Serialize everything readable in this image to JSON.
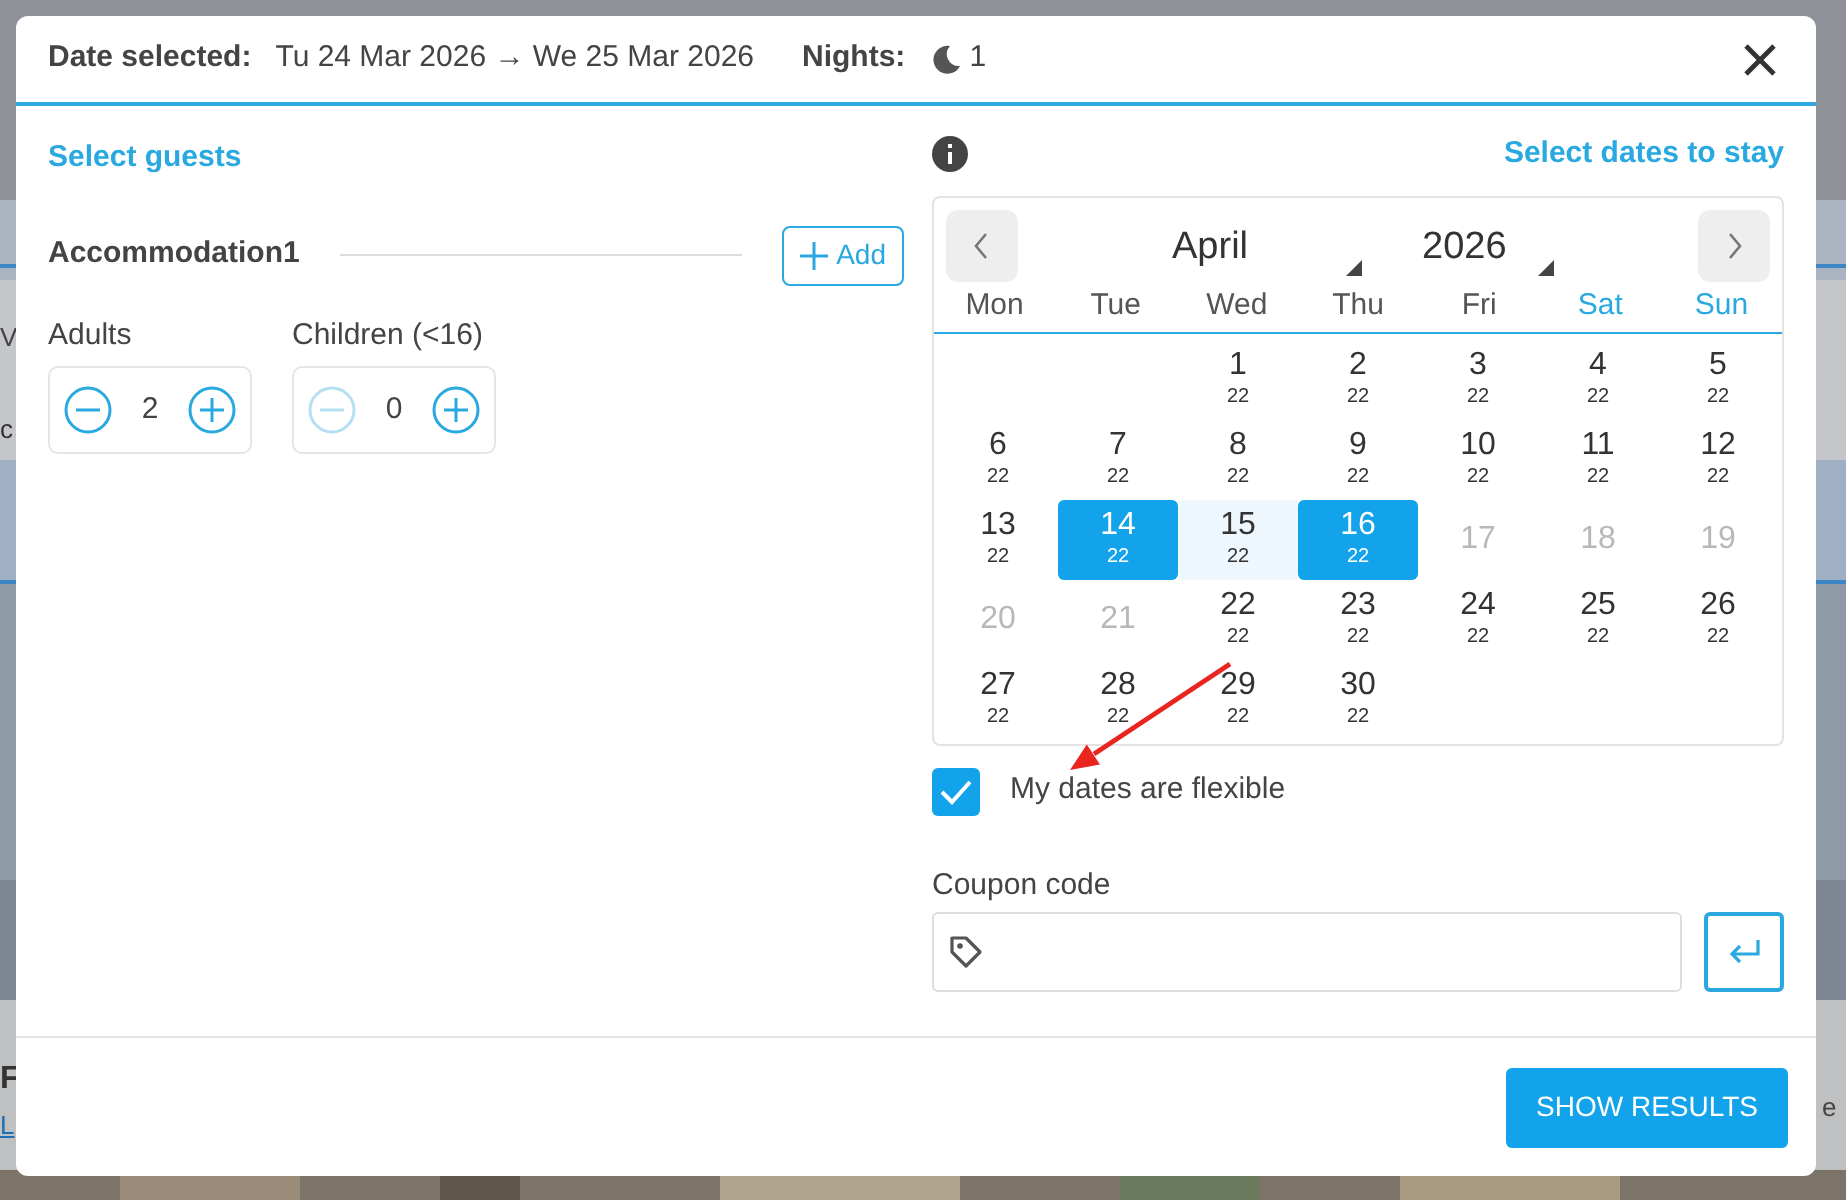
{
  "background_texts": [
    {
      "text": "V",
      "kind": "left"
    },
    {
      "text": "c",
      "kind": "left"
    },
    {
      "text": "F",
      "kind": "heading"
    },
    {
      "text": "L",
      "kind": "link"
    },
    {
      "text": "e",
      "kind": "right"
    }
  ],
  "header": {
    "label": "Date selected:",
    "dates": "Tu 24 Mar 2026 → We 25 Mar 2026",
    "nights_label": "Nights:",
    "nights": "1"
  },
  "guests": {
    "title": "Select guests",
    "accommodation": "Accommodation1",
    "add_button": "Add",
    "counters": [
      {
        "label": "Adults",
        "value": "2",
        "minus_disabled": false
      },
      {
        "label": "Children (<16)",
        "value": "0",
        "minus_disabled": true
      }
    ]
  },
  "calendar": {
    "title": "Select dates to stay",
    "month": "April",
    "year": "2026",
    "weekdays": [
      {
        "label": "Mon",
        "weekend": false
      },
      {
        "label": "Tue",
        "weekend": false
      },
      {
        "label": "Wed",
        "weekend": false
      },
      {
        "label": "Thu",
        "weekend": false
      },
      {
        "label": "Fri",
        "weekend": false
      },
      {
        "label": "Sat",
        "weekend": true
      },
      {
        "label": "Sun",
        "weekend": true
      }
    ],
    "weeks": [
      [
        {
          "kind": "blank"
        },
        {
          "kind": "blank"
        },
        {
          "kind": "day",
          "day": "1",
          "price": "22",
          "selected": false,
          "in_range": false,
          "disabled": false
        },
        {
          "kind": "day",
          "day": "2",
          "price": "22",
          "selected": false,
          "in_range": false,
          "disabled": false
        },
        {
          "kind": "day",
          "day": "3",
          "price": "22",
          "selected": false,
          "in_range": false,
          "disabled": false
        },
        {
          "kind": "day",
          "day": "4",
          "price": "22",
          "selected": false,
          "in_range": false,
          "disabled": false
        },
        {
          "kind": "day",
          "day": "5",
          "price": "22",
          "selected": false,
          "in_range": false,
          "disabled": false
        }
      ],
      [
        {
          "kind": "day",
          "day": "6",
          "price": "22",
          "selected": false,
          "in_range": false,
          "disabled": false
        },
        {
          "kind": "day",
          "day": "7",
          "price": "22",
          "selected": false,
          "in_range": false,
          "disabled": false
        },
        {
          "kind": "day",
          "day": "8",
          "price": "22",
          "selected": false,
          "in_range": false,
          "disabled": false
        },
        {
          "kind": "day",
          "day": "9",
          "price": "22",
          "selected": false,
          "in_range": false,
          "disabled": false
        },
        {
          "kind": "day",
          "day": "10",
          "price": "22",
          "selected": false,
          "in_range": false,
          "disabled": false
        },
        {
          "kind": "day",
          "day": "11",
          "price": "22",
          "selected": false,
          "in_range": false,
          "disabled": false
        },
        {
          "kind": "day",
          "day": "12",
          "price": "22",
          "selected": false,
          "in_range": false,
          "disabled": false
        }
      ],
      [
        {
          "kind": "day",
          "day": "13",
          "price": "22",
          "selected": false,
          "in_range": false,
          "disabled": false
        },
        {
          "kind": "day",
          "day": "14",
          "price": "22",
          "selected": true,
          "in_range": false,
          "disabled": false
        },
        {
          "kind": "day",
          "day": "15",
          "price": "22",
          "selected": false,
          "in_range": true,
          "disabled": false
        },
        {
          "kind": "day",
          "day": "16",
          "price": "22",
          "selected": true,
          "in_range": false,
          "disabled": false
        },
        {
          "kind": "day",
          "day": "17",
          "selected": false,
          "in_range": false,
          "disabled": true
        },
        {
          "kind": "day",
          "day": "18",
          "selected": false,
          "in_range": false,
          "disabled": true
        },
        {
          "kind": "day",
          "day": "19",
          "selected": false,
          "in_range": false,
          "disabled": true
        }
      ],
      [
        {
          "kind": "day",
          "day": "20",
          "selected": false,
          "in_range": false,
          "disabled": true
        },
        {
          "kind": "day",
          "day": "21",
          "selected": false,
          "in_range": false,
          "disabled": true
        },
        {
          "kind": "day",
          "day": "22",
          "price": "22",
          "selected": false,
          "in_range": false,
          "disabled": false
        },
        {
          "kind": "day",
          "day": "23",
          "price": "22",
          "selected": false,
          "in_range": false,
          "disabled": false
        },
        {
          "kind": "day",
          "day": "24",
          "price": "22",
          "selected": false,
          "in_range": false,
          "disabled": false
        },
        {
          "kind": "day",
          "day": "25",
          "price": "22",
          "selected": false,
          "in_range": false,
          "disabled": false
        },
        {
          "kind": "day",
          "day": "26",
          "price": "22",
          "selected": false,
          "in_range": false,
          "disabled": false
        }
      ],
      [
        {
          "kind": "day",
          "day": "27",
          "price": "22",
          "selected": false,
          "in_range": false,
          "disabled": false
        },
        {
          "kind": "day",
          "day": "28",
          "price": "22",
          "selected": false,
          "in_range": false,
          "disabled": false
        },
        {
          "kind": "day",
          "day": "29",
          "price": "22",
          "selected": false,
          "in_range": false,
          "disabled": false
        },
        {
          "kind": "day",
          "day": "30",
          "price": "22",
          "selected": false,
          "in_range": false,
          "disabled": false
        },
        {
          "kind": "blank"
        },
        {
          "kind": "blank"
        },
        {
          "kind": "blank"
        }
      ]
    ]
  },
  "flexible": {
    "label": "My dates are flexible",
    "checked": true
  },
  "coupon": {
    "label": "Coupon code"
  },
  "submit_button": "SHOW RESULTS"
}
